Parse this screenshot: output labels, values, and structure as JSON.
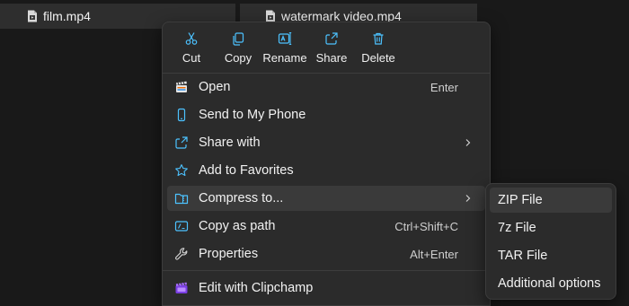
{
  "files": [
    {
      "name": "film.mp4",
      "icon": "video-file-icon"
    },
    {
      "name": "watermark video.mp4",
      "icon": "video-file-icon"
    }
  ],
  "quick_actions": [
    {
      "label": "Cut",
      "icon": "scissors-icon"
    },
    {
      "label": "Copy",
      "icon": "copy-icon"
    },
    {
      "label": "Rename",
      "icon": "rename-icon"
    },
    {
      "label": "Share",
      "icon": "share-icon"
    },
    {
      "label": "Delete",
      "icon": "trash-icon"
    }
  ],
  "menu_items": [
    {
      "label": "Open",
      "shortcut": "Enter",
      "icon": "clapperboard-icon"
    },
    {
      "label": "Send to My Phone",
      "shortcut": "",
      "icon": "phone-icon"
    },
    {
      "label": "Share with",
      "shortcut": "",
      "icon": "share-with-icon",
      "submenu": true
    },
    {
      "label": "Add to Favorites",
      "shortcut": "",
      "icon": "star-icon"
    },
    {
      "label": "Compress to...",
      "shortcut": "",
      "icon": "compress-folder-icon",
      "submenu": true,
      "highlighted": true
    },
    {
      "label": "Copy as path",
      "shortcut": "Ctrl+Shift+C",
      "icon": "copy-path-icon"
    },
    {
      "label": "Properties",
      "shortcut": "Alt+Enter",
      "icon": "wrench-icon"
    },
    {
      "label": "Edit with Clipchamp",
      "shortcut": "",
      "icon": "clipchamp-icon"
    }
  ],
  "compress_submenu": [
    {
      "label": "ZIP File",
      "highlighted": true
    },
    {
      "label": "7z File"
    },
    {
      "label": "TAR File"
    },
    {
      "label": "Additional options"
    }
  ],
  "colors": {
    "background": "#191919",
    "menu": "#2b2b2b",
    "hover": "#3a3a3a",
    "accent_blue": "#4cc2ff",
    "clipchamp_purple": "#7b3fe4"
  }
}
